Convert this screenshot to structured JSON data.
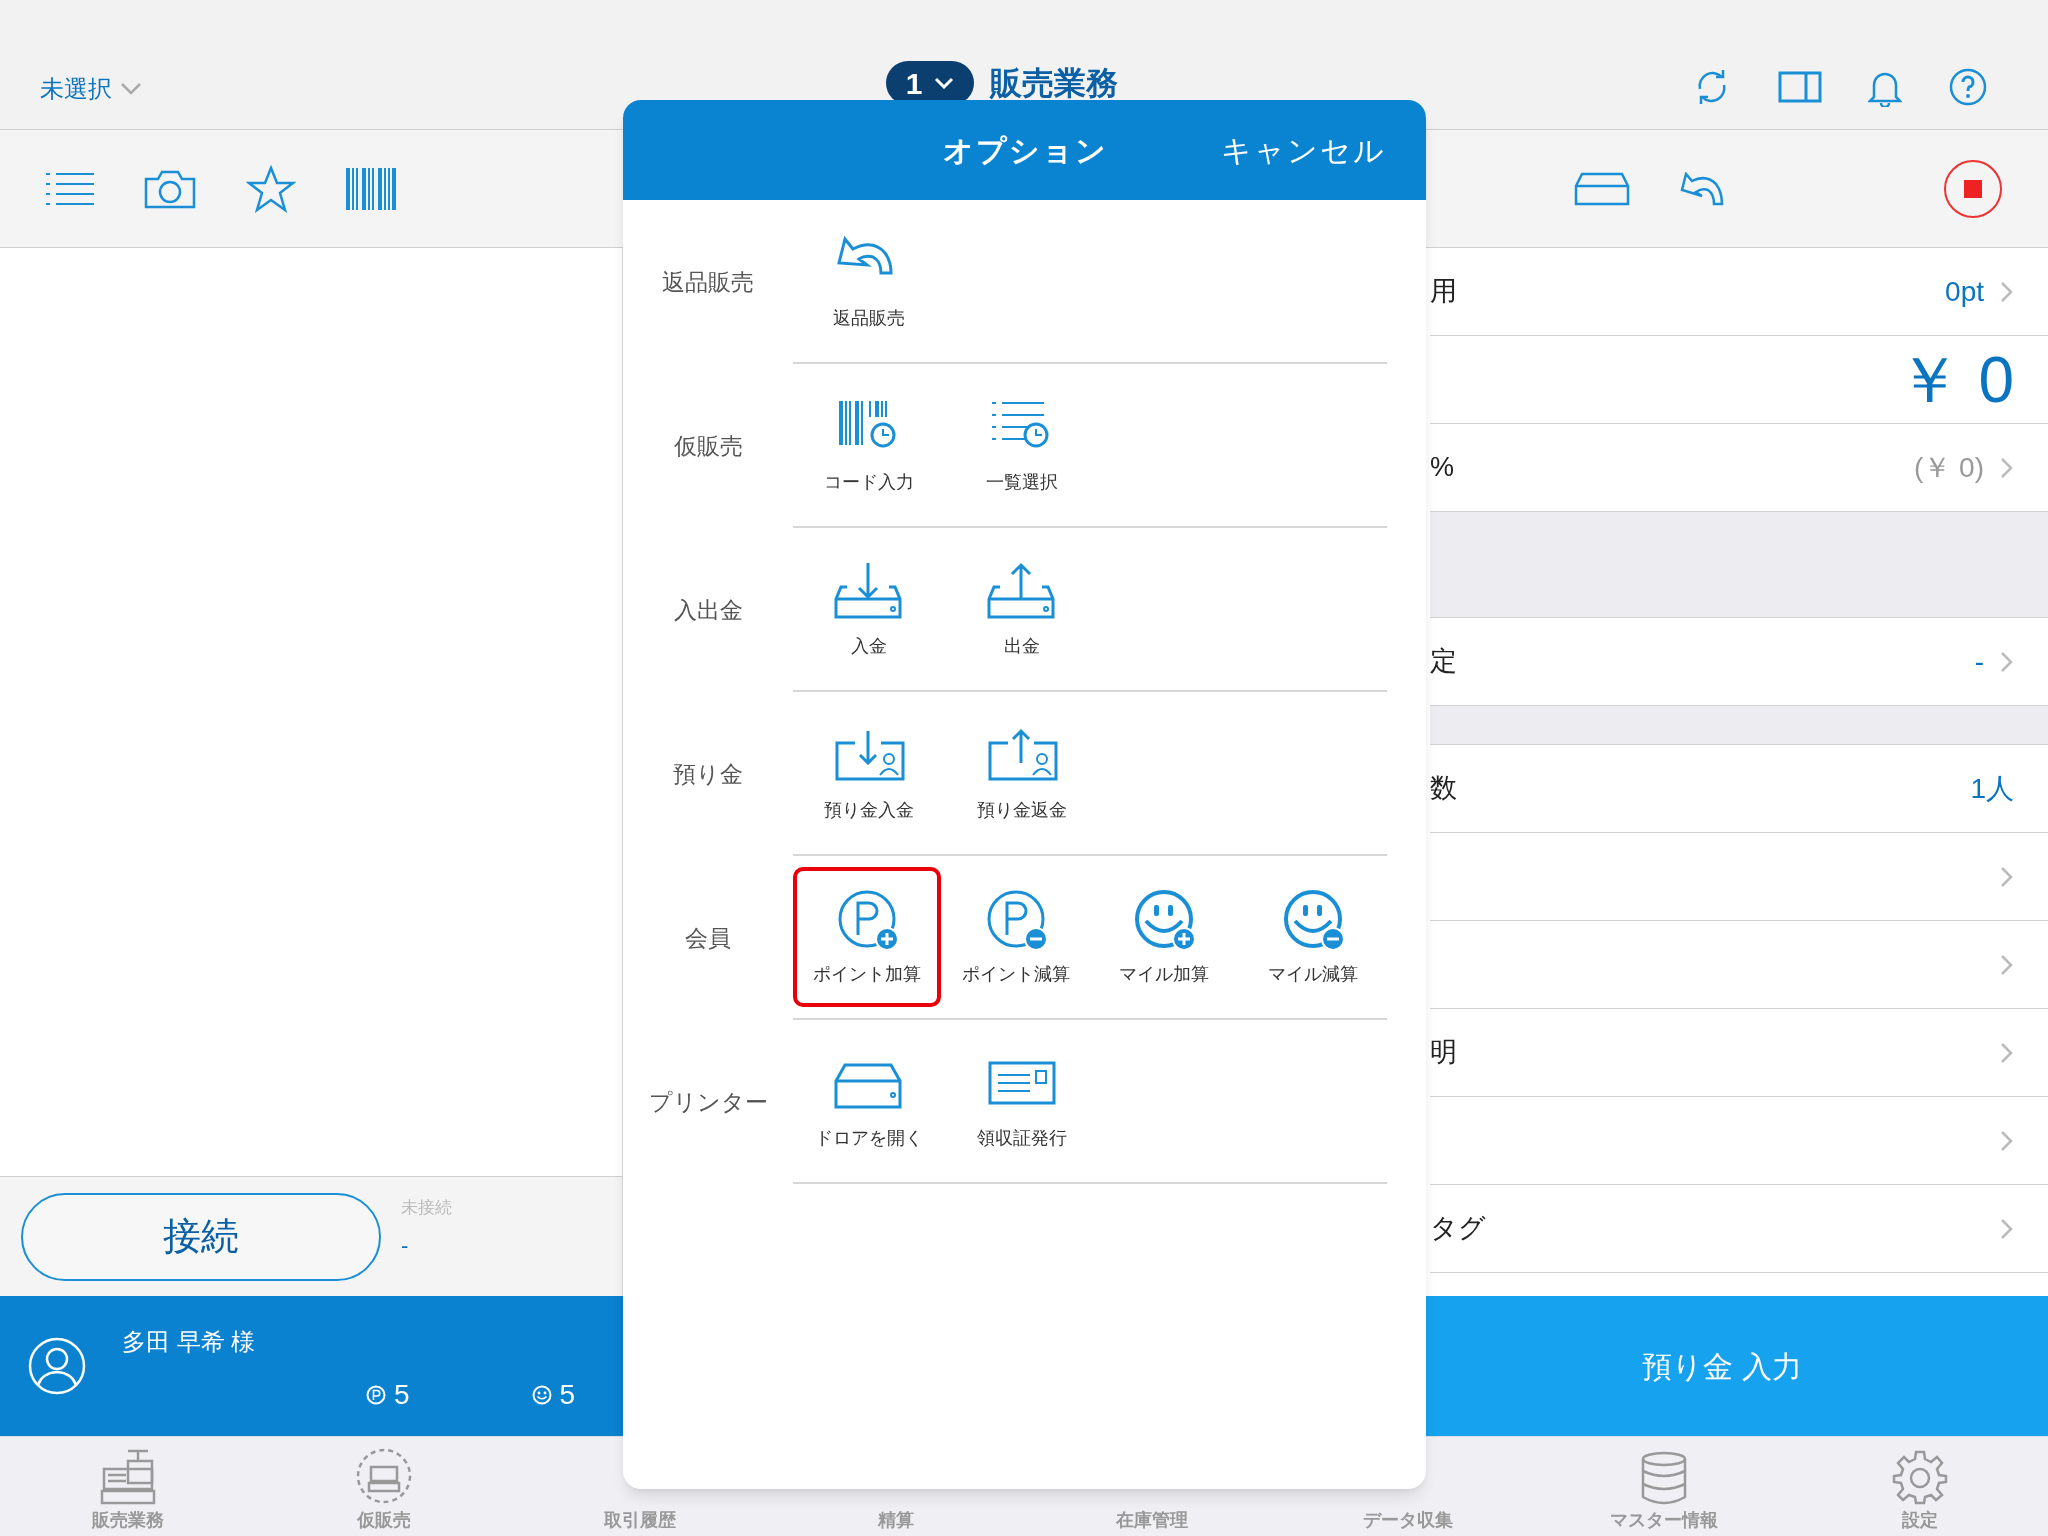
{
  "top_bar": {
    "staff_selector": "未選択",
    "register_number": "1",
    "title": "販売業務"
  },
  "left_panel": {
    "connect_button": "接続",
    "connection_status": "未接続",
    "connection_device": "-"
  },
  "customer": {
    "name": "多田 早希 様",
    "points": "5",
    "miles": "5"
  },
  "summary_rows": [
    {
      "kind": "row",
      "label": "用",
      "value": "0pt",
      "muted": false,
      "chevron": true
    },
    {
      "kind": "total",
      "value": "￥ 0"
    },
    {
      "kind": "row",
      "label": "%",
      "value": "(￥ 0)",
      "muted": true,
      "chevron": true
    },
    {
      "kind": "band"
    },
    {
      "kind": "row",
      "label": "定",
      "value": "-",
      "muted": false,
      "chevron": true
    },
    {
      "kind": "gap"
    },
    {
      "kind": "row",
      "label": "数",
      "value": "1人",
      "muted": false,
      "chevron": false
    },
    {
      "kind": "row",
      "chevron": true
    },
    {
      "kind": "row",
      "chevron": true
    },
    {
      "kind": "row",
      "label": "明",
      "chevron": true
    },
    {
      "kind": "row",
      "chevron": true
    },
    {
      "kind": "row",
      "label": "タグ",
      "chevron": true
    }
  ],
  "deposit_button": "預り金 入力",
  "tabs": [
    {
      "label": "販売業務",
      "selected": false
    },
    {
      "label": "仮販売",
      "selected": false
    },
    {
      "label": "取引履歴",
      "selected": false
    },
    {
      "label": "精算",
      "selected": false
    },
    {
      "label": "在庫管理",
      "selected": false
    },
    {
      "label": "データ収集",
      "selected": false
    },
    {
      "label": "マスター情報",
      "selected": false
    },
    {
      "label": "設定",
      "selected": false
    }
  ],
  "options_dialog": {
    "title": "オプション",
    "cancel": "キャンセル",
    "sections": [
      {
        "label": "返品販売",
        "items": [
          {
            "label": "返品販売",
            "selected": false
          }
        ]
      },
      {
        "label": "仮販売",
        "items": [
          {
            "label": "コード入力",
            "selected": false
          },
          {
            "label": "一覧選択",
            "selected": false
          }
        ]
      },
      {
        "label": "入出金",
        "items": [
          {
            "label": "入金",
            "selected": false
          },
          {
            "label": "出金",
            "selected": false
          }
        ]
      },
      {
        "label": "預り金",
        "items": [
          {
            "label": "預り金入金",
            "selected": false
          },
          {
            "label": "預り金返金",
            "selected": false
          }
        ]
      },
      {
        "label": "会員",
        "items": [
          {
            "label": "ポイント加算",
            "selected": true
          },
          {
            "label": "ポイント減算",
            "selected": false
          },
          {
            "label": "マイル加算",
            "selected": false
          },
          {
            "label": "マイル減算",
            "selected": false
          }
        ]
      },
      {
        "label": "プリンター",
        "items": [
          {
            "label": "ドロアを開く",
            "selected": false
          },
          {
            "label": "領収証発行",
            "selected": false
          }
        ]
      }
    ]
  }
}
